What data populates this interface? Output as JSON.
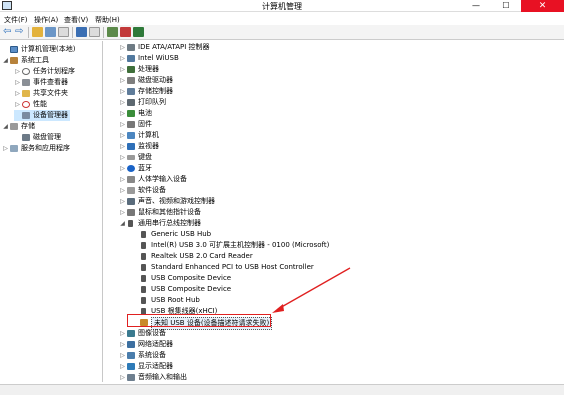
{
  "window": {
    "title": "计算机管理",
    "min_glyph": "—",
    "max_glyph": "☐",
    "close_glyph": "✕"
  },
  "menu": {
    "file": "文件(F)",
    "action": "操作(A)",
    "view": "查看(V)",
    "help": "帮助(H)"
  },
  "toolbar": {
    "back_glyph": "⇦",
    "forward_glyph": "⇨"
  },
  "left_tree": [
    {
      "label": "计算机管理(本地)",
      "arrow": ""
    },
    {
      "label": "系统工具",
      "arrow": "◢"
    },
    {
      "label": "任务计划程序",
      "arrow": "▷"
    },
    {
      "label": "事件查看器",
      "arrow": "▷"
    },
    {
      "label": "共享文件夹",
      "arrow": "▷"
    },
    {
      "label": "性能",
      "arrow": "▷"
    },
    {
      "label": "设备管理器",
      "arrow": ""
    },
    {
      "label": "存储",
      "arrow": "◢"
    },
    {
      "label": "磁盘管理",
      "arrow": ""
    },
    {
      "label": "服务和应用程序",
      "arrow": "▷"
    }
  ],
  "device_tree": [
    {
      "label": "IDE ATA/ATAPI 控制器",
      "arrow": "▷"
    },
    {
      "label": "Intel WiUSB",
      "arrow": "▷"
    },
    {
      "label": "处理器",
      "arrow": "▷"
    },
    {
      "label": "磁盘驱动器",
      "arrow": "▷"
    },
    {
      "label": "存储控制器",
      "arrow": "▷"
    },
    {
      "label": "打印队列",
      "arrow": "▷"
    },
    {
      "label": "电池",
      "arrow": "▷"
    },
    {
      "label": "固件",
      "arrow": "▷"
    },
    {
      "label": "计算机",
      "arrow": "▷"
    },
    {
      "label": "监视器",
      "arrow": "▷"
    },
    {
      "label": "键盘",
      "arrow": "▷"
    },
    {
      "label": "蓝牙",
      "arrow": "▷"
    },
    {
      "label": "人体学输入设备",
      "arrow": "▷"
    },
    {
      "label": "软件设备",
      "arrow": "▷"
    },
    {
      "label": "声音、视频和游戏控制器",
      "arrow": "▷"
    },
    {
      "label": "鼠标和其他指针设备",
      "arrow": "▷"
    },
    {
      "label": "通用串行总线控制器",
      "arrow": "◢"
    },
    {
      "label": "Generic USB Hub",
      "arrow": ""
    },
    {
      "label": "Intel(R) USB 3.0 可扩展主机控制器 - 0100 (Microsoft)",
      "arrow": ""
    },
    {
      "label": "Realtek USB 2.0 Card Reader",
      "arrow": ""
    },
    {
      "label": "Standard Enhanced PCI to USB Host Controller",
      "arrow": ""
    },
    {
      "label": "USB Composite Device",
      "arrow": ""
    },
    {
      "label": "USB Composite Device",
      "arrow": ""
    },
    {
      "label": "USB Root Hub",
      "arrow": ""
    },
    {
      "label": "USB 根集线器(xHCI)",
      "arrow": ""
    },
    {
      "label": "未知 USB 设备(设备描述符请求失败)",
      "arrow": ""
    },
    {
      "label": "图像设备",
      "arrow": "▷"
    },
    {
      "label": "网络适配器",
      "arrow": "▷"
    },
    {
      "label": "系统设备",
      "arrow": "▷"
    },
    {
      "label": "显示适配器",
      "arrow": "▷"
    },
    {
      "label": "音频输入和输出",
      "arrow": "▷"
    }
  ],
  "colors": {
    "highlight_box": "#e02020",
    "annotation_arrow": "#e02020",
    "selection": "#cce8ff"
  }
}
